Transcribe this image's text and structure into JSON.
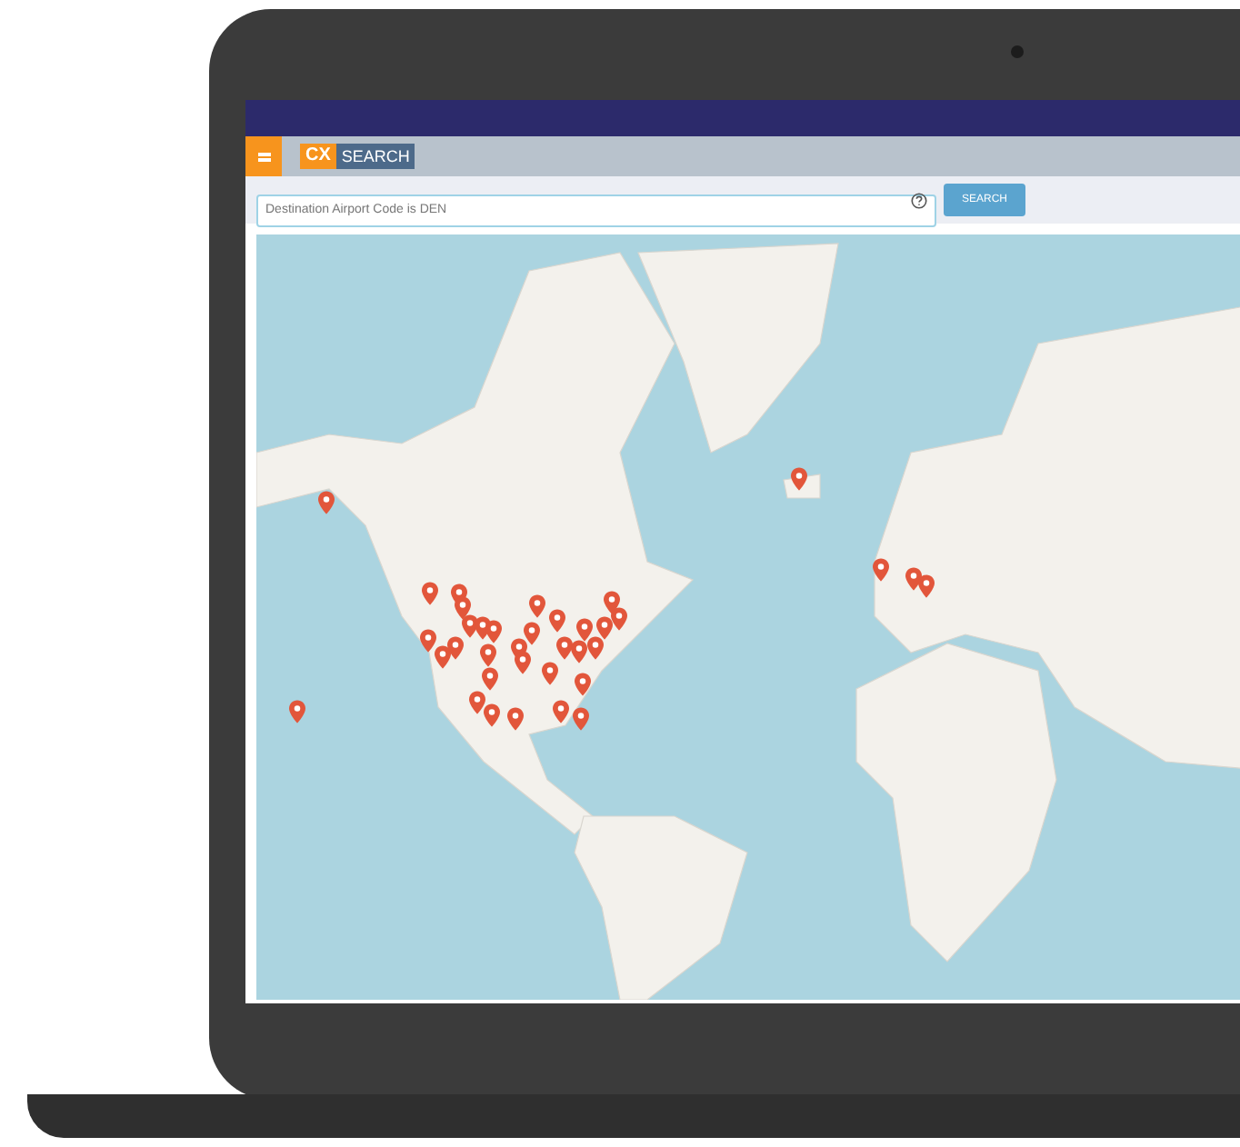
{
  "header": {
    "logo_badge": "CX",
    "logo_text": "SEARCH"
  },
  "search": {
    "value": "Destination Airport Code is DEN",
    "button": "SEARCH"
  }
}
